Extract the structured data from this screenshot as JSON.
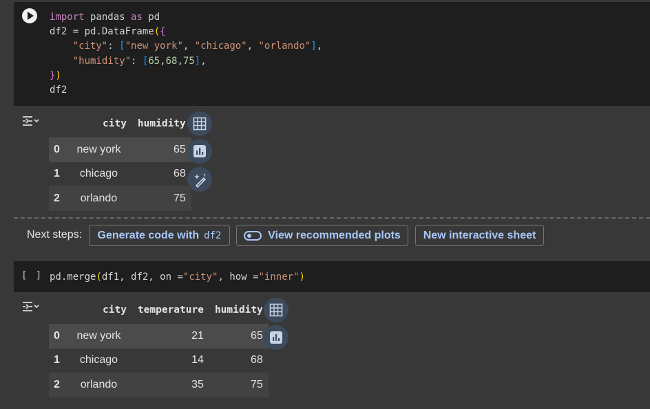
{
  "cell1": {
    "lines": [
      [
        [
          "kw",
          "import"
        ],
        [
          "t",
          " pandas "
        ],
        [
          "kw",
          "as"
        ],
        [
          "t",
          " pd"
        ]
      ],
      [
        [
          "t",
          "df2 = pd.DataFrame"
        ],
        [
          "brk-y",
          "("
        ],
        [
          "brk-p",
          "{"
        ]
      ],
      [
        [
          "t",
          "    "
        ],
        [
          "str",
          "\"city\""
        ],
        [
          "t",
          ": "
        ],
        [
          "brk-b",
          "["
        ],
        [
          "str",
          "\"new york\""
        ],
        [
          "t",
          ", "
        ],
        [
          "str",
          "\"chicago\""
        ],
        [
          "t",
          ", "
        ],
        [
          "str",
          "\"orlando\""
        ],
        [
          "brk-b",
          "]"
        ],
        [
          "t",
          ","
        ]
      ],
      [
        [
          "t",
          "    "
        ],
        [
          "str",
          "\"humidity\""
        ],
        [
          "t",
          ": "
        ],
        [
          "brk-b",
          "["
        ],
        [
          "num",
          "65"
        ],
        [
          "t",
          ","
        ],
        [
          "num",
          "68"
        ],
        [
          "t",
          ","
        ],
        [
          "num",
          "75"
        ],
        [
          "brk-b",
          "]"
        ],
        [
          "t",
          ","
        ]
      ],
      [
        [
          "brk-p",
          "}"
        ],
        [
          "brk-y",
          ")"
        ]
      ],
      [
        [
          "t",
          "df2"
        ]
      ]
    ]
  },
  "output1": {
    "columns": [
      "",
      "city",
      "humidity"
    ],
    "rows": [
      [
        "0",
        "new york",
        "65"
      ],
      [
        "1",
        "chicago",
        "68"
      ],
      [
        "2",
        "orlando",
        "75"
      ]
    ]
  },
  "next_steps": {
    "label": "Next steps:",
    "generate_label": "Generate code with",
    "generate_var": "df2",
    "plots_label": "View recommended plots",
    "sheet_label": "New interactive sheet"
  },
  "cell2": {
    "bracket": "[ ]",
    "lines": [
      [
        [
          "t",
          "pd.merge"
        ],
        [
          "brk-y",
          "("
        ],
        [
          "t",
          "df1, df2, on ="
        ],
        [
          "str",
          "\"city\""
        ],
        [
          "t",
          ", how ="
        ],
        [
          "str",
          "\"inner\""
        ],
        [
          "brk-y",
          ")"
        ]
      ]
    ]
  },
  "output2": {
    "columns": [
      "",
      "city",
      "temperature",
      "humidity"
    ],
    "rows": [
      [
        "0",
        "new york",
        "21",
        "65"
      ],
      [
        "1",
        "chicago",
        "14",
        "68"
      ],
      [
        "2",
        "orlando",
        "35",
        "75"
      ]
    ]
  },
  "colors": {
    "cell_bg": "#1e1e1e",
    "page_bg": "#383838",
    "accent": "#a8c7fa",
    "keyword": "#c586c0",
    "string": "#ce9178",
    "number": "#b5cea8"
  }
}
